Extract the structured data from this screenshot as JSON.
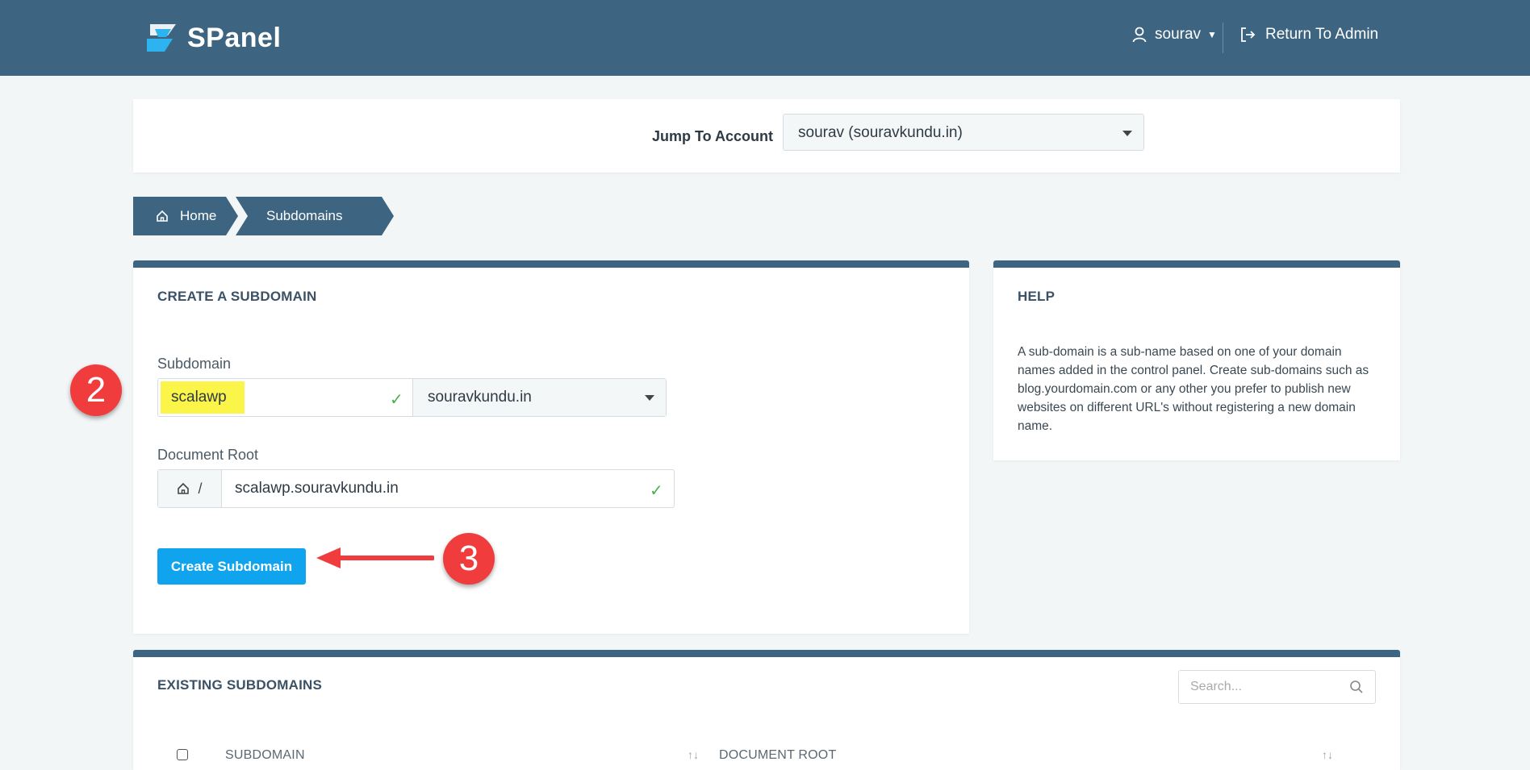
{
  "header": {
    "logo_text": "SPanel",
    "username": "sourav",
    "return_admin_label": "Return To Admin"
  },
  "jump": {
    "label": "Jump To Account",
    "selected": "sourav (souravkundu.in)"
  },
  "breadcrumb": {
    "home": "Home",
    "current": "Subdomains"
  },
  "create": {
    "title": "CREATE A SUBDOMAIN",
    "subdomain_label": "Subdomain",
    "subdomain_value": "scalawp",
    "domain_selected": "souravkundu.in",
    "docroot_label": "Document Root",
    "docroot_prefix": "/",
    "docroot_value": "scalawp.souravkundu.in",
    "button_label": "Create Subdomain"
  },
  "annotations": {
    "step2": "2",
    "step3": "3"
  },
  "help": {
    "title": "HELP",
    "text": "A sub-domain is a sub-name based on one of your domain names added in the control panel. Create sub-domains such as blog.yourdomain.com or any other you prefer to publish new websites on different URL's without registering a new domain name."
  },
  "existing": {
    "title": "EXISTING SUBDOMAINS",
    "search_placeholder": "Search...",
    "columns": [
      "SUBDOMAIN",
      "DOCUMENT ROOT"
    ],
    "sort_glyph": "↑↓"
  },
  "colors": {
    "header_bg": "#3d6480",
    "button_blue": "#10a4ee",
    "badge_red": "#f03c3c",
    "highlight_yellow": "#fbf54a",
    "valid_green": "#4caf50"
  }
}
